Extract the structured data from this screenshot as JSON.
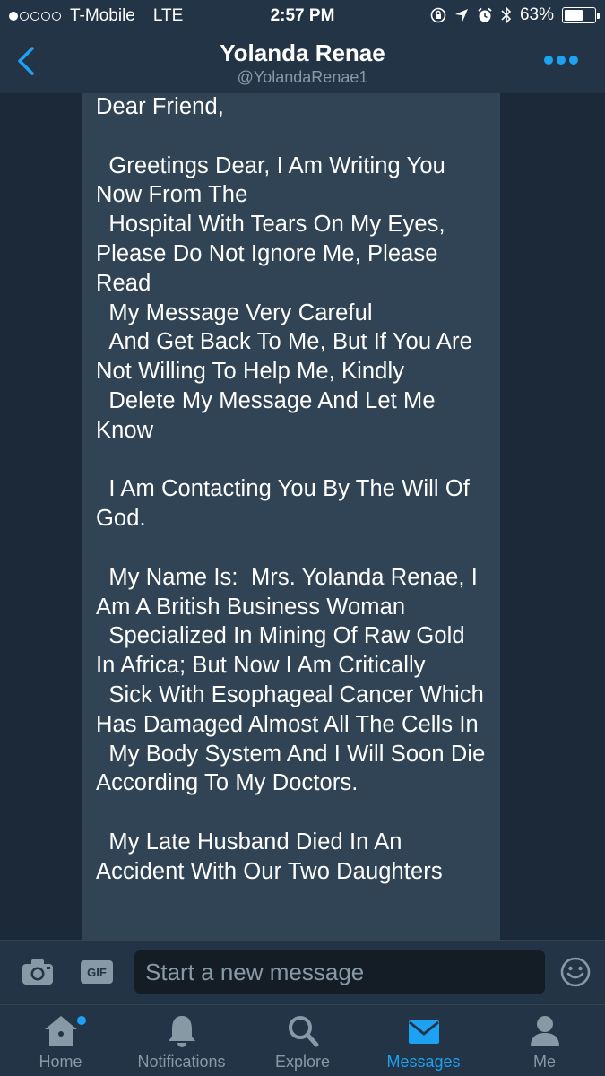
{
  "status_bar": {
    "carrier": "T-Mobile",
    "network": "LTE",
    "time": "2:57 PM",
    "battery": "63%",
    "battery_level": 0.63,
    "signal_bars_filled": 1,
    "signal_bars_total": 5
  },
  "header": {
    "title": "Yolanda Renae",
    "handle": "@YolandaRenae1"
  },
  "message": {
    "text": "Dear Friend,\n\n  Greetings Dear, I Am Writing You Now From The\n  Hospital With Tears On My Eyes, Please Do Not Ignore Me, Please Read\n  My Message Very Careful\n  And Get Back To Me, But If You Are Not Willing To Help Me, Kindly\n  Delete My Message And Let Me Know\n\n  I Am Contacting You By The Will Of God.\n\n  My Name Is:  Mrs. Yolanda Renae, I Am A British Business Woman\n  Specialized In Mining Of Raw Gold In Africa; But Now I Am Critically\n  Sick With Esophageal Cancer Which Has Damaged Almost All The Cells In\n  My Body System And I Will Soon Die According To My Doctors.\n\n  My Late Husband Died In An Accident With Our Two Daughters"
  },
  "composer": {
    "placeholder": "Start a new message",
    "gif_label": "GIF"
  },
  "tabs": [
    {
      "label": "Home",
      "icon": "home-icon",
      "active": false,
      "badge": true
    },
    {
      "label": "Notifications",
      "icon": "bell-icon",
      "active": false,
      "badge": false
    },
    {
      "label": "Explore",
      "icon": "search-icon",
      "active": false,
      "badge": false
    },
    {
      "label": "Messages",
      "icon": "envelope-icon",
      "active": true,
      "badge": false
    },
    {
      "label": "Me",
      "icon": "person-icon",
      "active": false,
      "badge": false
    }
  ],
  "colors": {
    "accent": "#1da1f2",
    "background": "#1c2938",
    "bar": "#243447",
    "bubble": "#314455",
    "muted": "#8899a6"
  }
}
